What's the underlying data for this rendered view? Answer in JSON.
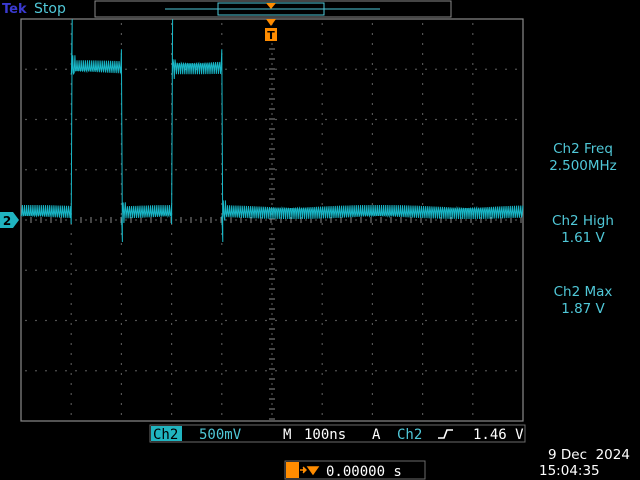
{
  "header": {
    "brand": "Tek",
    "run_state": "Stop"
  },
  "trigger_marker": "T",
  "channel_marker": "2",
  "measurements": [
    {
      "label": "Ch2 Freq",
      "value": "2.500MHz"
    },
    {
      "label": "Ch2 High",
      "value": "1.61 V"
    },
    {
      "label": "Ch2 Max",
      "value": "1.87 V"
    }
  ],
  "status_bar": {
    "channel": "Ch2",
    "volts_div": "500mV",
    "timebase_prefix": "M",
    "time_div": "100ns",
    "trigger_prefix": "A",
    "trigger_channel": "Ch2",
    "trigger_slope_icon": "rising-edge-icon",
    "trigger_level": "1.46 V"
  },
  "trigger_position": {
    "icon": "trigger-position-icon",
    "value": "0.00000 s"
  },
  "datetime": {
    "date": "9 Dec  2024",
    "time": "15:04:35"
  },
  "colors": {
    "trace": "#19b8c8",
    "accent": "#ff8c00",
    "label_bg": "#20b4c0",
    "text": "#50c8d8",
    "grid": "#8a8a8a"
  },
  "chart_data": {
    "type": "line",
    "xlabel": "",
    "ylabel": "",
    "grid": true,
    "series": [
      {
        "x": [
          0,
          100,
          100,
          200,
          200,
          300,
          300,
          400,
          400,
          500
        ],
        "y": [
          0.0,
          0.0,
          1.5,
          1.5,
          0.0,
          0.0,
          1.5,
          1.5,
          0.0,
          0.0
        ]
      }
    ]
  }
}
